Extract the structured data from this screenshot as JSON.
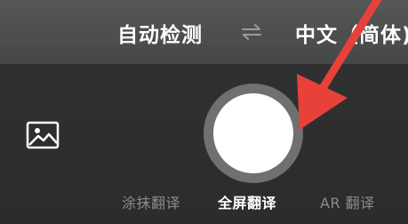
{
  "language_bar": {
    "source_language": "自动检测",
    "swap_icon": "swap-arrows-icon",
    "target_language": "中文（简体)"
  },
  "camera": {
    "gallery_icon": "image-gallery-icon",
    "shutter_icon": "shutter-button"
  },
  "modes": [
    {
      "label": "涂抹翻译",
      "active": false
    },
    {
      "label": "全屏翻译",
      "active": true
    },
    {
      "label": "AR 翻译",
      "active": false
    }
  ],
  "annotation": {
    "arrow_color": "#e8413a",
    "arrow_icon": "red-arrow-pointer"
  },
  "colors": {
    "active_tab": "#ffffff",
    "inactive_tab": "#8b8c8c",
    "shutter_fill": "#ffffff"
  }
}
